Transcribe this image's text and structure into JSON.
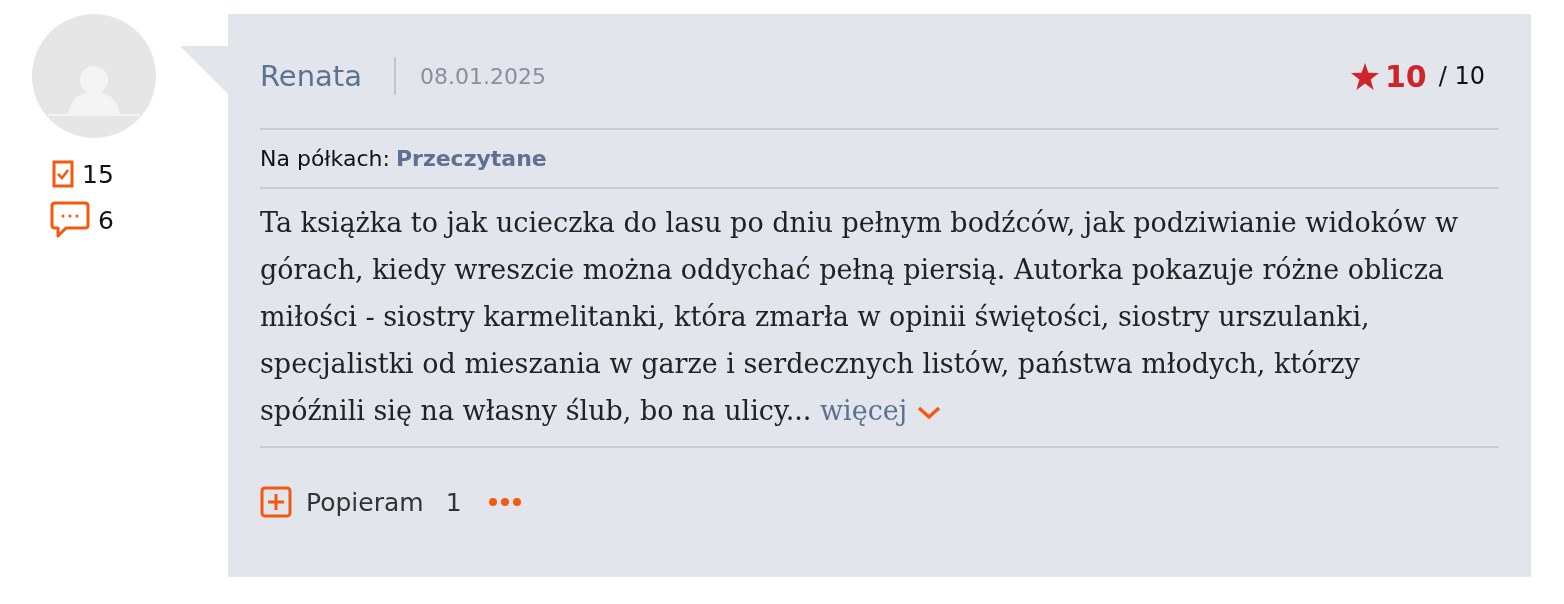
{
  "user": {
    "read_count": "15",
    "comment_count": "6"
  },
  "review": {
    "author": "Renata",
    "date": "08.01.2025",
    "rating": {
      "score": "10",
      "max": "/ 10"
    },
    "shelves": {
      "label": "Na półkach:",
      "shelf": "Przeczytane"
    },
    "text": "Ta książka to jak ucieczka do lasu po dniu pełnym bodźców, jak podziwianie widoków w górach, kiedy wreszcie można oddychać pełną piersią. Autorka pokazuje różne oblicza miłości - siostry karmelitanki, która zmarła w opinii świętości, siostry urszulanki, specjalistki od mieszania w garze i serdecznych listów, państwa młodych, którzy spóźnili się na własny ślub, bo na ulicy...",
    "more": "więcej",
    "support": {
      "label": "Popieram",
      "count": "1"
    }
  }
}
